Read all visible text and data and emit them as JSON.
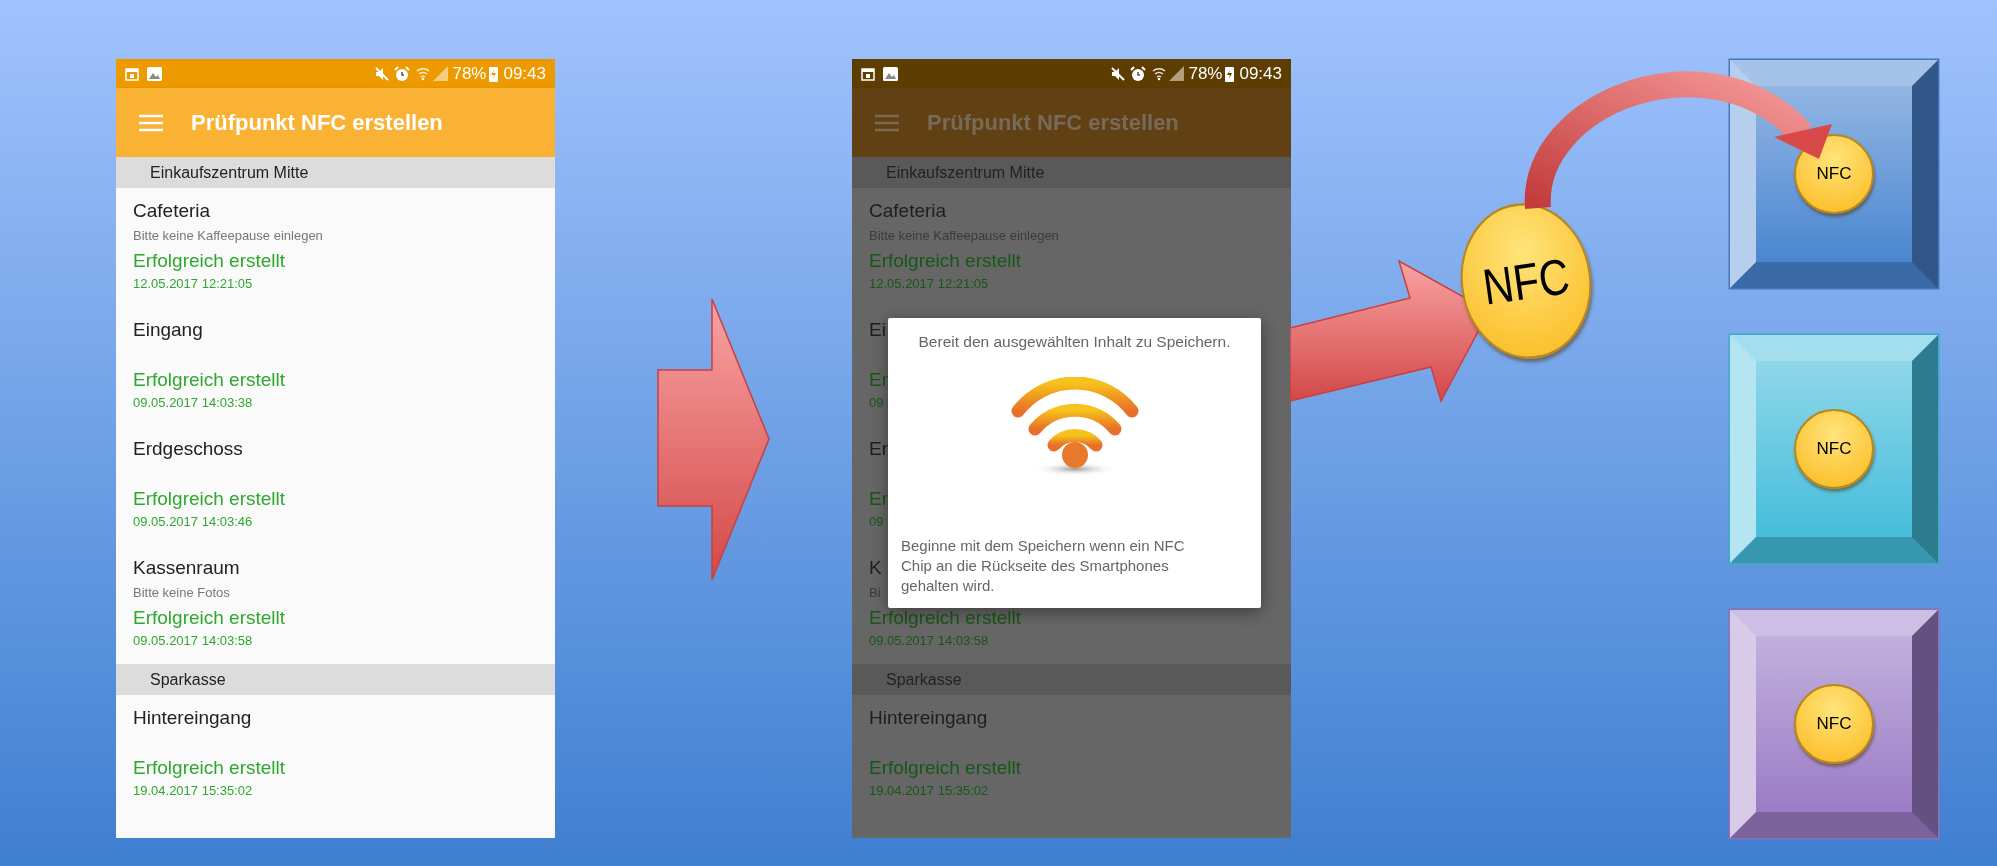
{
  "phones": [
    {
      "dimmed": false,
      "status_bar": {
        "battery": "78%",
        "time": "09:43"
      },
      "app_bar": {
        "title": "Prüfpunkt NFC erstellen"
      },
      "sections": [
        {
          "header": "Einkaufszentrum Mitte",
          "items": [
            {
              "title": "Cafeteria",
              "subtitle": "Bitte keine Kaffeepause einlegen",
              "status": "Erfolgreich erstellt",
              "date": "12.05.2017 12:21:05"
            },
            {
              "title": "Eingang",
              "status": "Erfolgreich erstellt",
              "date": "09.05.2017 14:03:38"
            },
            {
              "title": "Erdgeschoss",
              "status": "Erfolgreich erstellt",
              "date": "09.05.2017 14:03:46"
            },
            {
              "title": "Kassenraum",
              "subtitle": "Bitte keine Fotos",
              "status": "Erfolgreich erstellt",
              "date": "09.05.2017 14:03:58"
            }
          ]
        },
        {
          "header": "Sparkasse",
          "items": [
            {
              "title": "Hintereingang",
              "status": "Erfolgreich erstellt",
              "date": "19.04.2017 15:35:02"
            }
          ]
        }
      ]
    },
    {
      "dimmed": true,
      "status_bar": {
        "battery": "78%",
        "time": "09:43"
      },
      "app_bar": {
        "title": "Prüfpunkt NFC erstellen"
      },
      "sections": [
        {
          "header": "Einkaufszentrum Mitte",
          "items": [
            {
              "title": "Cafeteria",
              "subtitle": "Bitte keine Kaffeepause einlegen",
              "status": "Erfolgreich erstellt",
              "date": "12.05.2017 12:21:05"
            },
            {
              "title": "Ei",
              "status": "Er",
              "date": "09"
            },
            {
              "title": "Er",
              "status": "Er",
              "date": "09"
            },
            {
              "title": "K",
              "subtitle": "Bi",
              "status": "Erfolgreich erstellt",
              "date": "09.05.2017 14:03:58"
            }
          ]
        },
        {
          "header": "Sparkasse",
          "items": [
            {
              "title": "Hintereingang",
              "status": "Erfolgreich erstellt",
              "date": "19.04.2017 15:35:02"
            }
          ]
        }
      ],
      "dialog": {
        "title": "Bereit den ausgewählten Inhalt zu Speichern.",
        "message": "Beginne mit dem Speichern wenn ein NFC Chip an die Rückseite des Smartphones gehalten wird."
      }
    }
  ],
  "diagram": {
    "coin_label": "NFC",
    "boxes": [
      {
        "color": "#4a86d0",
        "label": "NFC"
      },
      {
        "color": "#45bddb",
        "label": "NFC"
      },
      {
        "color": "#9a7cc6",
        "label": "NFC"
      }
    ]
  }
}
